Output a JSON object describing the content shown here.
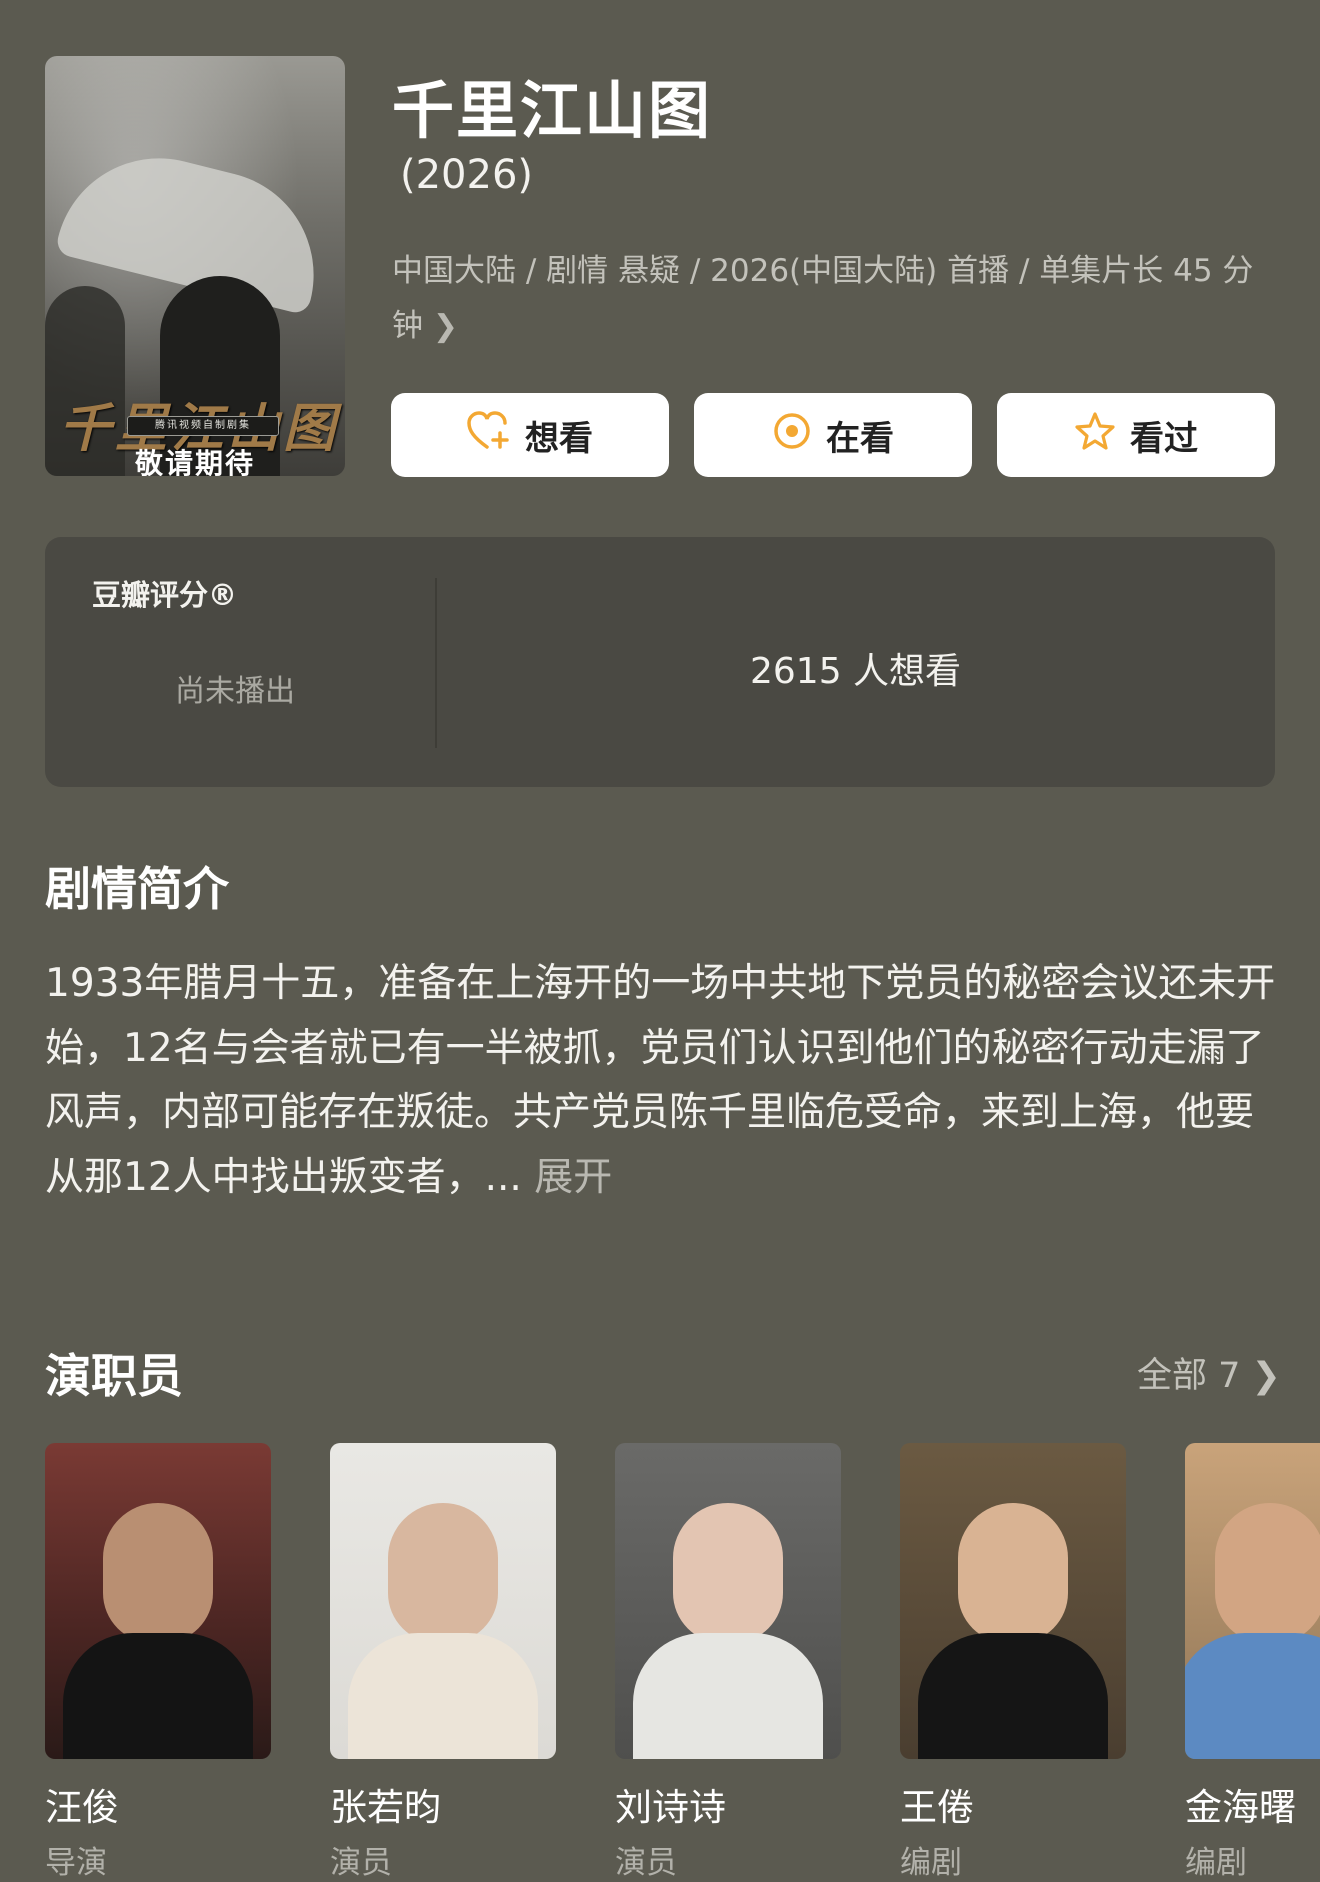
{
  "poster": {
    "title_art": "千里江山图",
    "tag": "腾讯视频自制剧集",
    "coming": "敬请期待"
  },
  "title": "千里江山图",
  "year": "(2026)",
  "meta": "中国大陆 / 剧情 悬疑 / 2026(中国大陆) 首播 / 单集片长 45 分钟",
  "actions": {
    "want": "想看",
    "watching": "在看",
    "watched": "看过"
  },
  "rating": {
    "label": "豆瓣评分®",
    "status": "尚未播出",
    "wish_count": "2615 人想看"
  },
  "synopsis": {
    "heading": "剧情简介",
    "text": "1933年腊月十五，准备在上海开的一场中共地下党员的秘密会议还未开始，12名与会者就已有一半被抓，党员们认识到他们的秘密行动走漏了风声，内部可能存在叛徒。共产党员陈千里临危受命，来到上海，他要从那12人中找出叛变者，",
    "ellipsis": "... ",
    "expand": "展开"
  },
  "cast": {
    "heading": "演职员",
    "all_label": "全部 7",
    "members": [
      {
        "name": "汪俊",
        "role": "导演"
      },
      {
        "name": "张若昀",
        "role": "演员"
      },
      {
        "name": "刘诗诗",
        "role": "演员"
      },
      {
        "name": "王倦",
        "role": "编剧"
      },
      {
        "name": "金海曙",
        "role": "编剧"
      }
    ]
  },
  "colors": {
    "background": "#5b5a50",
    "card": "#4a4943",
    "accent": "#f3a833"
  },
  "icons": {
    "want": "heart-plus-icon",
    "watching": "target-icon",
    "watched": "star-icon",
    "chevron": "chevron-right-icon"
  }
}
